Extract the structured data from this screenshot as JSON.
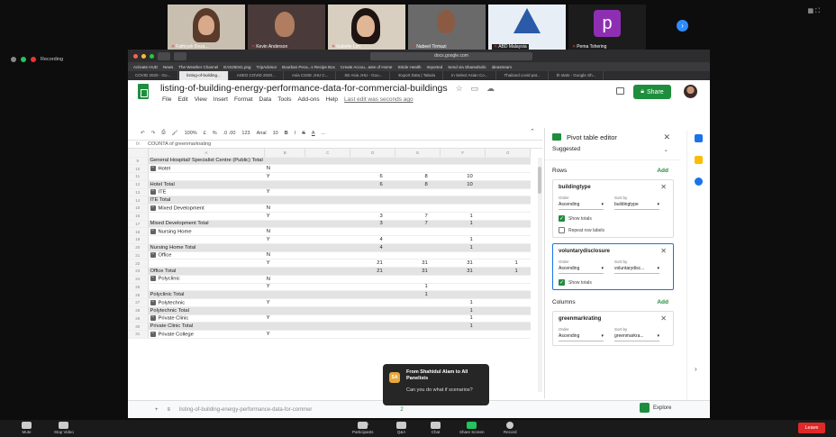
{
  "participants": [
    {
      "name": "Fathiyah Deza..."
    },
    {
      "name": "Kevin Anderson"
    },
    {
      "name": "Isabelle Lim"
    },
    {
      "name": "Nabeel Tirmazi"
    },
    {
      "name": "ABD Malaysia"
    },
    {
      "name": "Pema Tshering",
      "initial": "p"
    }
  ],
  "recording_label": "Recording",
  "browser": {
    "url": "docs.google.com",
    "bookmarks": [
      "Activate HUD",
      "News",
      "The Weather Channel",
      "EAS25041.png",
      "TripAdvisor",
      "Bourban Peca...s Recipe Box",
      "Create Accou...aste of Home",
      "Stride Health",
      "Imported",
      "Send via Shareaholic",
      "ideastream"
    ],
    "tabs": [
      "COVID 2020 - Go...",
      "listing-of-building...",
      "ASEO COVID 2020...",
      "Asia CSSE JHU C...",
      "SE Asia JHU - Goo...",
      "Export Data | Tabula",
      "In Select Asian Co...",
      "Thailand covid pat...",
      "th stats - Google Sh..."
    ]
  },
  "doc": {
    "title": "listing-of-building-energy-performance-data-for-commercial-buildings",
    "menu": [
      "File",
      "Edit",
      "View",
      "Insert",
      "Format",
      "Data",
      "Tools",
      "Add-ons",
      "Help"
    ],
    "last_edit": "Last edit was seconds ago",
    "share_label": "Share"
  },
  "toolbar": {
    "zoom": "100%",
    "currency": "£",
    "percent": "%",
    "decimals": ".0 .00",
    "format": "123",
    "font": "Arial",
    "size": "10",
    "bold": "B",
    "italic": "I",
    "strike": "S",
    "color": "A",
    "more": "..."
  },
  "formula_bar": "COUNTA of greenmarkrating",
  "column_headers": [
    "A",
    "B",
    "C",
    "D",
    "E",
    "F",
    "G"
  ],
  "rows": [
    {
      "n": "9",
      "a": "General Hospital/ Specialist Centre (Public) Total",
      "b": "",
      "d": "",
      "e": "",
      "f": "",
      "g": "",
      "total": true,
      "box": false
    },
    {
      "n": "10",
      "a": "Hotel",
      "b": "N",
      "d": "",
      "e": "",
      "f": "",
      "g": "",
      "total": false,
      "box": true
    },
    {
      "n": "11",
      "a": "",
      "b": "Y",
      "d": "6",
      "e": "8",
      "f": "10",
      "g": "",
      "total": false,
      "box": false
    },
    {
      "n": "12",
      "a": "Hotel Total",
      "b": "",
      "d": "6",
      "e": "8",
      "f": "10",
      "g": "",
      "total": true,
      "box": false
    },
    {
      "n": "13",
      "a": "ITE",
      "b": "Y",
      "d": "",
      "e": "",
      "f": "",
      "g": "",
      "total": false,
      "box": true
    },
    {
      "n": "14",
      "a": "ITE Total",
      "b": "",
      "d": "",
      "e": "",
      "f": "",
      "g": "",
      "total": true,
      "box": false
    },
    {
      "n": "15",
      "a": "Mixed Development",
      "b": "N",
      "d": "",
      "e": "",
      "f": "",
      "g": "",
      "total": false,
      "box": true
    },
    {
      "n": "16",
      "a": "",
      "b": "Y",
      "d": "3",
      "e": "7",
      "f": "1",
      "g": "",
      "total": false,
      "box": false
    },
    {
      "n": "17",
      "a": "Mixed Development Total",
      "b": "",
      "d": "3",
      "e": "7",
      "f": "1",
      "g": "",
      "total": true,
      "box": false
    },
    {
      "n": "18",
      "a": "Nursing Home",
      "b": "N",
      "d": "",
      "e": "",
      "f": "",
      "g": "",
      "total": false,
      "box": true
    },
    {
      "n": "19",
      "a": "",
      "b": "Y",
      "d": "4",
      "e": "",
      "f": "1",
      "g": "",
      "total": false,
      "box": false
    },
    {
      "n": "20",
      "a": "Nursing Home Total",
      "b": "",
      "d": "4",
      "e": "",
      "f": "1",
      "g": "",
      "total": true,
      "box": false
    },
    {
      "n": "21",
      "a": "Office",
      "b": "N",
      "d": "",
      "e": "",
      "f": "",
      "g": "",
      "total": false,
      "box": true
    },
    {
      "n": "22",
      "a": "",
      "b": "Y",
      "d": "21",
      "e": "31",
      "f": "31",
      "g": "1",
      "total": false,
      "box": false
    },
    {
      "n": "23",
      "a": "Office Total",
      "b": "",
      "d": "21",
      "e": "31",
      "f": "31",
      "g": "1",
      "total": true,
      "box": false
    },
    {
      "n": "24",
      "a": "Polyclinic",
      "b": "N",
      "d": "",
      "e": "",
      "f": "",
      "g": "",
      "total": false,
      "box": true
    },
    {
      "n": "25",
      "a": "",
      "b": "Y",
      "d": "",
      "e": "1",
      "f": "",
      "g": "",
      "total": false,
      "box": false
    },
    {
      "n": "26",
      "a": "Polyclinic Total",
      "b": "",
      "d": "",
      "e": "1",
      "f": "",
      "g": "",
      "total": true,
      "box": false
    },
    {
      "n": "27",
      "a": "Polytechnic",
      "b": "Y",
      "d": "",
      "e": "",
      "f": "1",
      "g": "",
      "total": false,
      "box": true
    },
    {
      "n": "28",
      "a": "Polytechnic Total",
      "b": "",
      "d": "",
      "e": "",
      "f": "1",
      "g": "",
      "total": true,
      "box": false
    },
    {
      "n": "29",
      "a": "Private Clinic",
      "b": "Y",
      "d": "",
      "e": "",
      "f": "1",
      "g": "",
      "total": false,
      "box": true
    },
    {
      "n": "30",
      "a": "Private Clinic Total",
      "b": "",
      "d": "",
      "e": "",
      "f": "1",
      "g": "",
      "total": true,
      "box": false
    },
    {
      "n": "31",
      "a": "Private College",
      "b": "Y",
      "d": "",
      "e": "",
      "f": "",
      "g": "",
      "total": false,
      "box": true
    }
  ],
  "sheet_tab": "listing-of-building-energy-performance-data-for-commer",
  "sheet_tab_2": "2",
  "explore_label": "Explore",
  "pivot": {
    "title": "Pivot table editor",
    "suggested": "Suggested",
    "rows_label": "Rows",
    "add_label": "Add",
    "columns_label": "Columns",
    "order_label": "Order",
    "sort_label": "Sort by",
    "fields": [
      {
        "name": "buildingtype",
        "order": "Ascending",
        "sort": "buildingtype",
        "show_totals": "Show totals",
        "repeat": "Repeat row labels"
      },
      {
        "name": "voluntarydisclosure",
        "order": "Ascending",
        "sort": "voluntarydisc...",
        "show_totals": "Show totals"
      },
      {
        "name": "greenmarkrating",
        "order": "Ascending",
        "sort": "greenmarkra..."
      }
    ]
  },
  "chat_toast": {
    "initials": "SA",
    "from": "From Shahidul Alam to All Panelists",
    "message": "Can you do what if scenarios?"
  },
  "controls": {
    "mute": "Mute",
    "stop_video": "Stop Video",
    "participants": "Participants",
    "participant_count": "34",
    "qa": "Q&A",
    "chat": "Chat",
    "share": "Share Screen",
    "record": "Record",
    "leave": "Leave"
  },
  "colors": {
    "sheets_green": "#1e8e3e",
    "zoom_blue": "#2d8cff",
    "leave_red": "#e02828",
    "total_row": "#e3e3e3"
  }
}
